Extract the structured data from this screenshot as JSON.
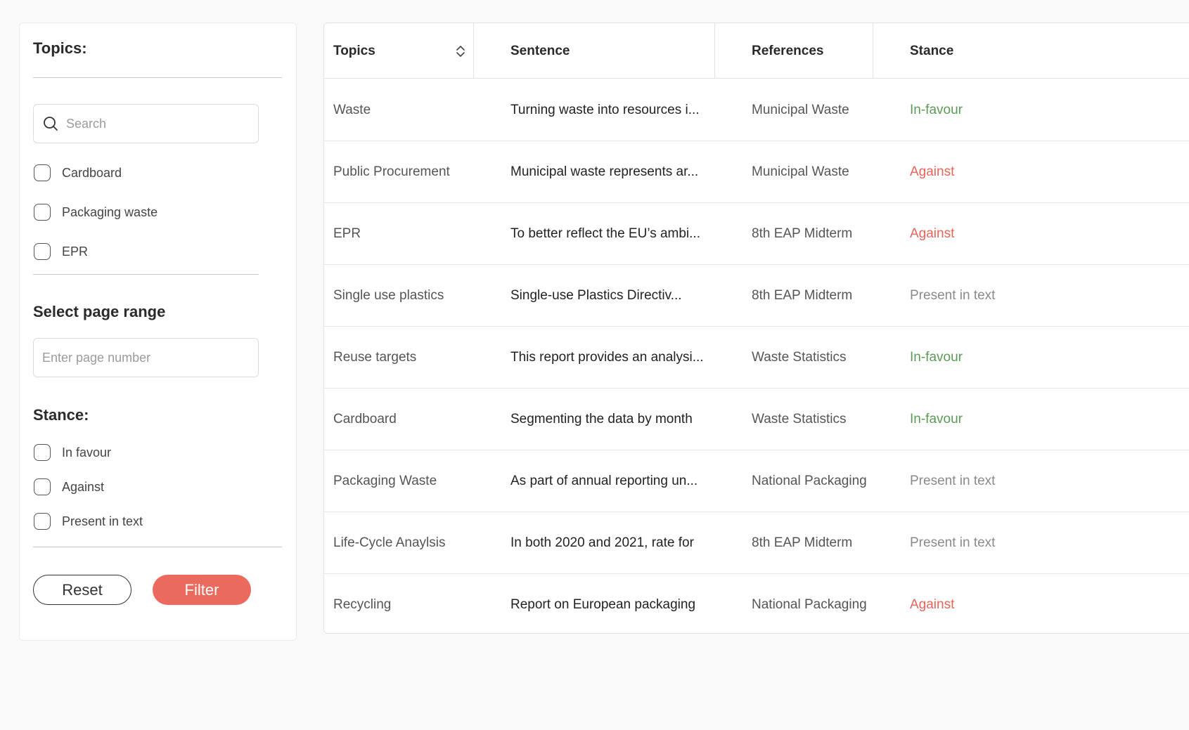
{
  "sidebar": {
    "topics_heading": "Topics:",
    "search_placeholder": "Search",
    "topics": [
      "Cardboard",
      "Packaging waste",
      "EPR"
    ],
    "page_range_heading": "Select page range",
    "page_placeholder": "Enter page number",
    "stance_heading": "Stance:",
    "stances": [
      "In favour",
      "Against",
      "Present in text"
    ],
    "reset_label": "Reset",
    "filter_label": "Filter"
  },
  "table": {
    "columns": [
      "Topics",
      "Sentence",
      "References",
      "Stance"
    ],
    "rows": [
      {
        "topic": "Waste",
        "sentence": "Turning waste into resources i...",
        "reference": "Municipal Waste",
        "stance": "In-favour",
        "stance_type": "favour"
      },
      {
        "topic": "Public Procurement",
        "sentence": "Municipal waste represents ar...",
        "reference": "Municipal Waste",
        "stance": "Against",
        "stance_type": "against"
      },
      {
        "topic": "EPR",
        "sentence": "To better reflect the EU’s ambi...",
        "reference": "8th EAP Midterm",
        "stance": "Against",
        "stance_type": "against"
      },
      {
        "topic": "Single use plastics",
        "sentence": "Single-use Plastics Directiv...",
        "reference": "8th EAP Midterm",
        "stance": "Present in text",
        "stance_type": "present"
      },
      {
        "topic": "Reuse targets",
        "sentence": "This report provides an analysi...",
        "reference": "Waste Statistics",
        "stance": "In-favour",
        "stance_type": "favour"
      },
      {
        "topic": "Cardboard",
        "sentence": "Segmenting the data by month",
        "reference": "Waste Statistics",
        "stance": "In-favour",
        "stance_type": "favour"
      },
      {
        "topic": "Packaging Waste",
        "sentence": "As part of annual reporting un...",
        "reference": "National Packaging",
        "stance": "Present in text",
        "stance_type": "present"
      },
      {
        "topic": "Life-Cycle Anaylsis",
        "sentence": "In both 2020 and 2021, rate for",
        "reference": "8th EAP Midterm",
        "stance": "Present in text",
        "stance_type": "present"
      },
      {
        "topic": "Recycling",
        "sentence": "Report on European packaging",
        "reference": "National Packaging",
        "stance": "Against",
        "stance_type": "against"
      }
    ]
  },
  "colors": {
    "accent": "#eb6a5e",
    "favour": "#5b9a55",
    "against": "#e8645a",
    "present": "#8a8a8a"
  },
  "icons": {
    "search": "search-icon",
    "sort": "sort-icon"
  }
}
